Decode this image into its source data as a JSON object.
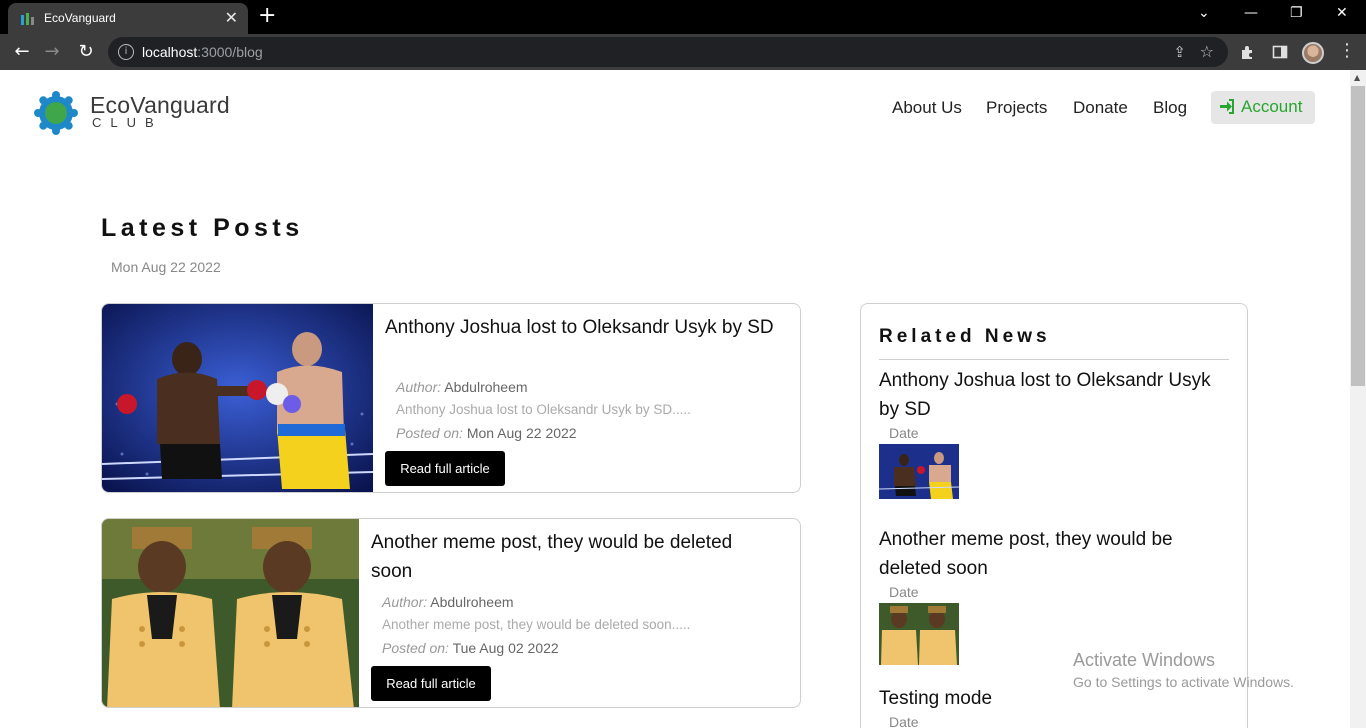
{
  "browser": {
    "tab_title": "EcoVanguard",
    "tab_close": "✕",
    "new_tab": "+",
    "url_host": "localhost",
    "url_path": ":3000/blog",
    "window_controls": {
      "chevron": "⌄",
      "minimize": "—",
      "restore": "❐",
      "close": "✕"
    }
  },
  "site": {
    "brand_name": "EcoVanguard",
    "brand_sub": "CLUB",
    "nav": [
      "About Us",
      "Projects",
      "Donate",
      "Blog"
    ],
    "account_label": "Account",
    "accent_color": "#27a52f"
  },
  "latest": {
    "heading": "Latest Posts",
    "date": "Mon Aug 22 2022"
  },
  "posts": [
    {
      "title": "Anthony Joshua lost to Oleksandr Usyk by SD",
      "author_label": "Author:",
      "author": "Abdulroheem",
      "excerpt": "Anthony Joshua lost to Oleksandr Usyk by SD.....",
      "posted_label": "Posted on:",
      "posted_date": "Mon Aug 22 2022",
      "button": "Read full article",
      "image": "boxing-photo"
    },
    {
      "title": "Another meme post, they would be deleted soon",
      "author_label": "Author:",
      "author": "Abdulroheem",
      "excerpt": "Another meme post, they would be deleted soon.....",
      "posted_label": "Posted on:",
      "posted_date": "Tue Aug 02 2022",
      "button": "Read full article",
      "image": "meme-photo"
    }
  ],
  "related": {
    "heading": "Related News",
    "items": [
      {
        "title": "Anthony Joshua lost to Oleksandr Usyk by SD",
        "date_label": "Date",
        "image": "boxing-photo"
      },
      {
        "title": "Another meme post, they would be deleted soon",
        "date_label": "Date",
        "image": "meme-photo"
      },
      {
        "title": "Testing mode",
        "date_label": "Date"
      }
    ]
  },
  "os_watermark": {
    "line1": "Activate Windows",
    "line2": "Go to Settings to activate Windows."
  }
}
